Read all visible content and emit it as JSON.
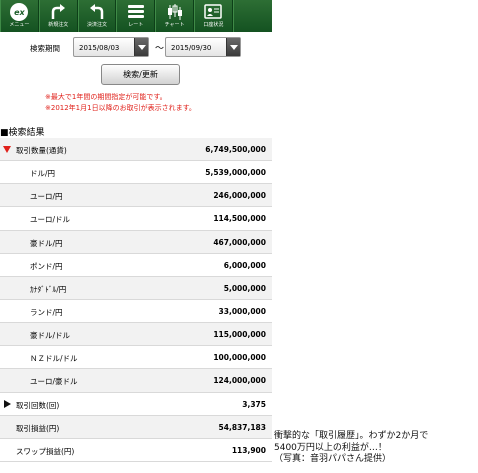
{
  "toolbar": {
    "items": [
      {
        "label": "メニュー",
        "icon": "ex-logo-icon"
      },
      {
        "label": "新規注文",
        "icon": "new-order-arrow-icon"
      },
      {
        "label": "決済注文",
        "icon": "settlement-arrow-icon"
      },
      {
        "label": "レート",
        "icon": "rate-list-icon"
      },
      {
        "label": "チャート",
        "icon": "candlestick-chart-icon"
      },
      {
        "label": "口座状況",
        "icon": "account-card-icon"
      }
    ],
    "logo_text": "ex"
  },
  "search": {
    "period_label": "検索期間",
    "date_from": "2015/08/03",
    "separator": "〜",
    "date_to": "2015/09/30",
    "button_label": "検索/更新",
    "note1": "※最大で1年間の期間指定が可能です。",
    "note2": "※2012年1月1日以降のお取引が表示されます。"
  },
  "results": {
    "heading": "■検索結果",
    "rows": [
      {
        "label": "取引数量(通貨)",
        "value": "6,749,500,000"
      },
      {
        "label": "ドル/円",
        "value": "5,539,000,000"
      },
      {
        "label": "ユーロ/円",
        "value": "246,000,000"
      },
      {
        "label": "ユーロ/ドル",
        "value": "114,500,000"
      },
      {
        "label": "豪ドル/円",
        "value": "467,000,000"
      },
      {
        "label": "ポンド/円",
        "value": "6,000,000"
      },
      {
        "label": "ｶﾅﾀﾞﾄﾞﾙ/円",
        "value": "5,000,000"
      },
      {
        "label": "ランド/円",
        "value": "33,000,000"
      },
      {
        "label": "豪ドル/ドル",
        "value": "115,000,000"
      },
      {
        "label": "ＮＺドル/ドル",
        "value": "100,000,000"
      },
      {
        "label": "ユーロ/豪ドル",
        "value": "124,000,000"
      },
      {
        "label": "取引回数(回)",
        "value": "3,375"
      },
      {
        "label": "取引損益(円)",
        "value": "54,837,183"
      },
      {
        "label": "スワップ損益(円)",
        "value": "113,900"
      }
    ]
  },
  "caption": {
    "line1": "衝撃的な「取引履歴」。わずか2か月で",
    "line2": "5400万円以上の利益が…！",
    "line3": "（写真：音羽パパさん提供）"
  },
  "colors": {
    "toolbar_green": "#1d5e2a",
    "note_red": "#e0201a",
    "alt_row": "#f2f2f2"
  }
}
